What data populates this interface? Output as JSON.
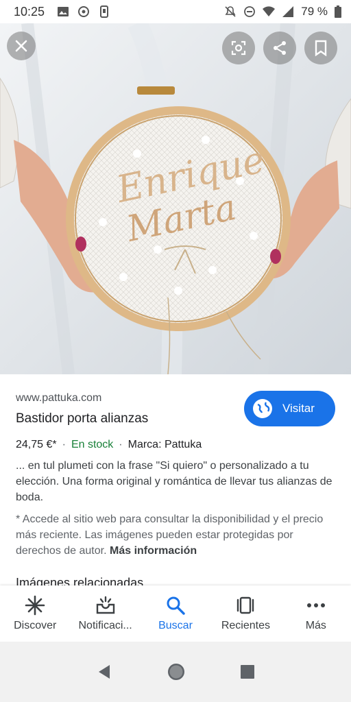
{
  "status_bar": {
    "time": "10:25",
    "battery": "79 %"
  },
  "hero_actions": {
    "close_label": "close",
    "lens_label": "lens",
    "share_label": "share",
    "save_label": "save"
  },
  "result": {
    "domain": "www.pattuka.com",
    "title": "Bastidor porta alianzas",
    "visit_label": "Visitar",
    "price": "24,75 €*",
    "separator": "·",
    "stock": "En stock",
    "brand": "Marca: Pattuka",
    "description": "... en tul plumeti con la frase \"Si quiero\" o personalizado a tu elección. Una forma original y romántica de llevar tus alianzas de boda.",
    "note": "* Accede al sitio web para consultar la disponibilidad y el precio más reciente. Las imágenes pueden estar protegidas por derechos de autor.",
    "more_info": "Más información",
    "related_heading": "Imágenes relacionadas"
  },
  "bottom_nav": {
    "items": [
      {
        "label": "Discover",
        "icon": "asterisk-icon"
      },
      {
        "label": "Notificaci...",
        "icon": "inbox-notification-icon"
      },
      {
        "label": "Buscar",
        "icon": "search-icon"
      },
      {
        "label": "Recientes",
        "icon": "recent-cards-icon"
      },
      {
        "label": "Más",
        "icon": "more-dots-icon"
      }
    ],
    "active_index": 2
  },
  "colors": {
    "accent": "#1a73e8",
    "stock_green": "#188038"
  }
}
